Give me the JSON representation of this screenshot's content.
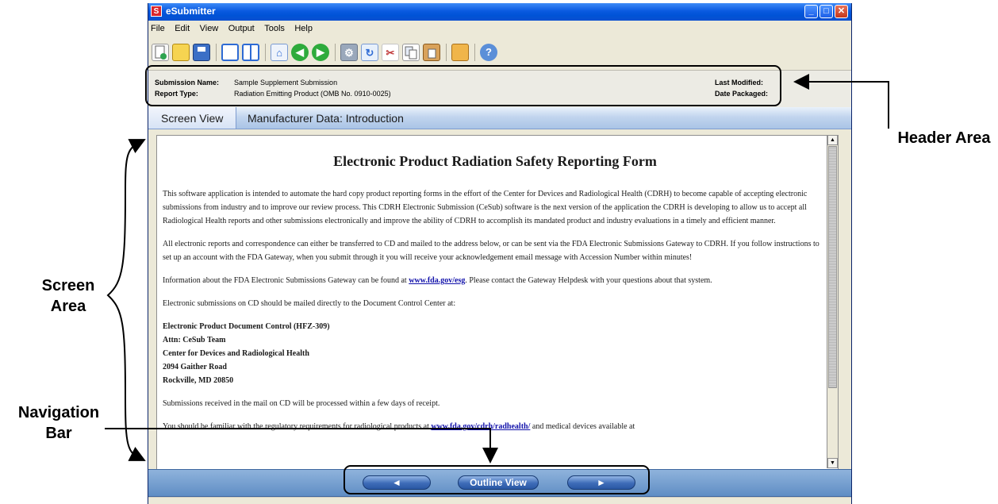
{
  "window": {
    "title": "eSubmitter",
    "app_icon": "S",
    "controls": {
      "minimize": "_",
      "maximize": "□",
      "close": "✕"
    }
  },
  "menu": [
    "File",
    "Edit",
    "View",
    "Output",
    "Tools",
    "Help"
  ],
  "toolbar_icons": [
    "new-icon",
    "open-icon",
    "save-icon",
    "window-icon",
    "split-view-icon",
    "home-icon",
    "back-icon",
    "forward-icon",
    "tools-icon",
    "refresh-icon",
    "cut-icon",
    "copy-icon",
    "paste-icon",
    "package-icon",
    "help-icon"
  ],
  "header": {
    "submission_name_label": "Submission Name:",
    "submission_name": "Sample Supplement Submission",
    "report_type_label": "Report Type:",
    "report_type": "Radiation Emitting Product (OMB No. 0910-0025)",
    "last_modified_label": "Last Modified:",
    "date_packaged_label": "Date Packaged:"
  },
  "tabbar": {
    "tab": "Screen View",
    "title": "Manufacturer Data: Introduction"
  },
  "document": {
    "title": "Electronic Product Radiation Safety Reporting Form",
    "p1": "This software application is intended to automate the hard copy product reporting forms in the effort of the Center for Devices and Radiological Health (CDRH) to become capable of accepting electronic submissions from industry and to improve our review process. This CDRH Electronic Submission (CeSub) software is the next version of the application the CDRH is developing to allow us to accept all Radiological Health reports and other submissions electronically and improve the ability of CDRH to accomplish its mandated product and industry evaluations in a timely and efficient manner.",
    "p2": "All electronic reports and correspondence can either be transferred to CD and mailed to the address below, or can be sent via the FDA Electronic Submissions Gateway to CDRH. If you follow instructions to set up an account with the FDA Gateway, when you submit through it you will receive your acknowledgement email message with Accession Number within minutes!",
    "p3_before": "Information about the FDA Electronic Submissions Gateway can be found at ",
    "p3_link": "www.fda.gov/esg",
    "p3_after": ". Please contact the Gateway Helpdesk with your questions about that system.",
    "p4": "Electronic submissions on CD should be mailed directly to the Document Control Center at:",
    "address": [
      "Electronic Product Document Control (HFZ-309)",
      "Attn: CeSub Team",
      "Center for Devices and Radiological Health",
      "2094 Gaither Road",
      "Rockville, MD 20850"
    ],
    "p5": "Submissions received in the mail on CD will be processed within a few days of receipt.",
    "p6_before": "You should be familiar with the regulatory requirements for radiological products at ",
    "p6_link": "www.fda.gov/cdrh/radhealth/",
    "p6_after": " and medical devices available at"
  },
  "navigation": {
    "back": "◄",
    "outline": "Outline View",
    "next": "►"
  },
  "annotations": {
    "header_area": "Header Area",
    "screen_area": "Screen Area",
    "navigation_bar": "Navigation Bar"
  },
  "colors": {
    "titlebar": "#0a5ae0",
    "tabbar": "#c2d5ee",
    "navbar": "#6f9bd0",
    "link": "#1111aa"
  }
}
